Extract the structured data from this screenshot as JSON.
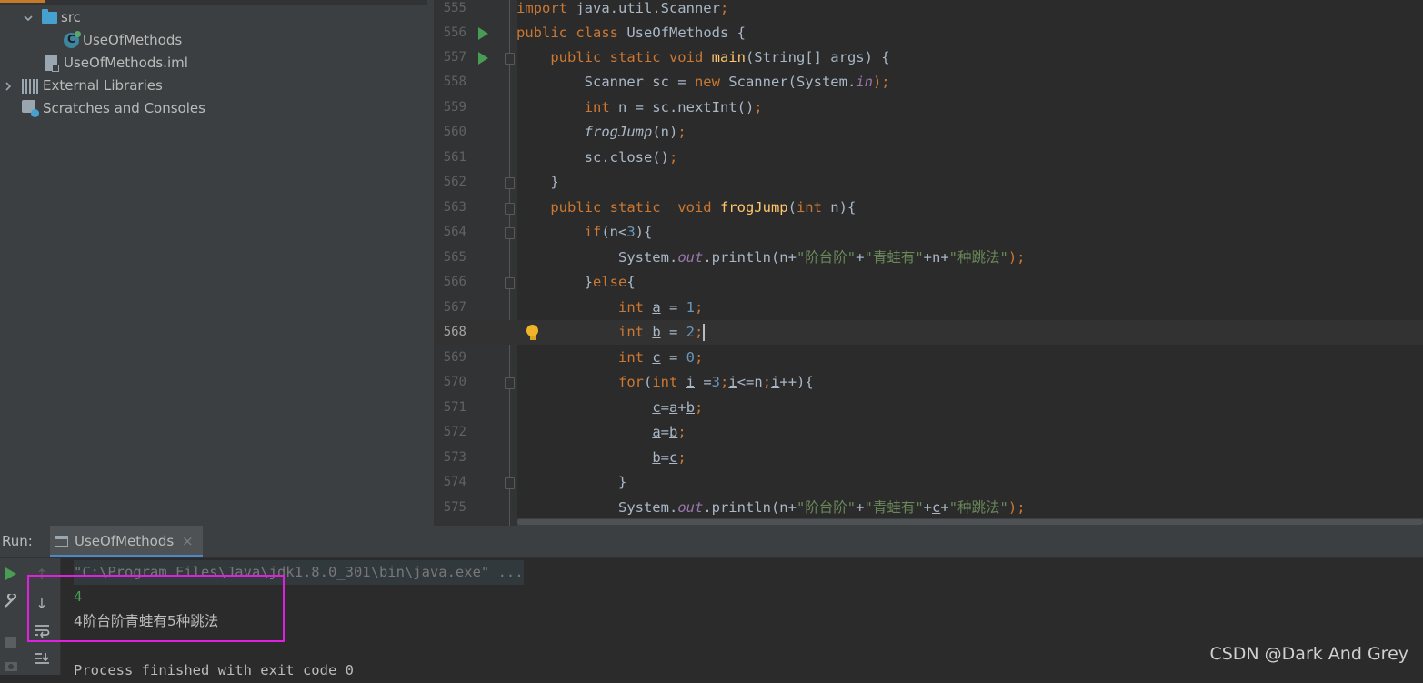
{
  "project_tree": {
    "items": [
      {
        "label": "src",
        "icon": "folder-icon"
      },
      {
        "label": "UseOfMethods",
        "icon": "java-class-icon"
      },
      {
        "label": "UseOfMethods.iml",
        "icon": "iml-file-icon"
      },
      {
        "label": "External Libraries",
        "icon": "library-icon"
      },
      {
        "label": "Scratches and Consoles",
        "icon": "scratches-icon"
      }
    ]
  },
  "editor": {
    "current_line": "568",
    "line_numbers": [
      "555",
      "556",
      "557",
      "558",
      "559",
      "560",
      "561",
      "562",
      "563",
      "564",
      "565",
      "566",
      "567",
      "568",
      "569",
      "570",
      "571",
      "572",
      "573",
      "574",
      "575"
    ],
    "lines": [
      "import java.util.Scanner;",
      "public class UseOfMethods {",
      "    public static void main(String[] args) {",
      "        Scanner sc = new Scanner(System.in);",
      "        int n = sc.nextInt();",
      "        frogJump(n);",
      "        sc.close();",
      "    }",
      "    public static  void frogJump(int n){",
      "        if(n<3){",
      "            System.out.println(n+\"阶台阶\"+\"青蛙有\"+n+\"种跳法\");",
      "        }else{",
      "            int a = 1;",
      "            int b = 2;",
      "            int c = 0;",
      "            for(int i =3;i<=n;i++){",
      "                c=a+b;",
      "                a=b;",
      "                b=c;",
      "            }",
      "            System.out.println(n+\"阶台阶\"+\"青蛙有\"+c+\"种跳法\");"
    ]
  },
  "run_panel": {
    "title": "Run:",
    "tab_label": "UseOfMethods",
    "tab_close": "×",
    "console": {
      "command": "\"C:\\Program Files\\Java\\jdk1.8.0_301\\bin\\java.exe\" ...",
      "input": "4",
      "output": "4阶台阶青蛙有5种跳法",
      "finished": "Process finished with exit code 0"
    }
  },
  "watermark": "CSDN @Dark And Grey",
  "colors": {
    "keyword": "#cc7832",
    "function": "#ffc66d",
    "number": "#6897bb",
    "string": "#6a8759",
    "static_field": "#9876aa",
    "highlight_box": "#e020e0"
  }
}
